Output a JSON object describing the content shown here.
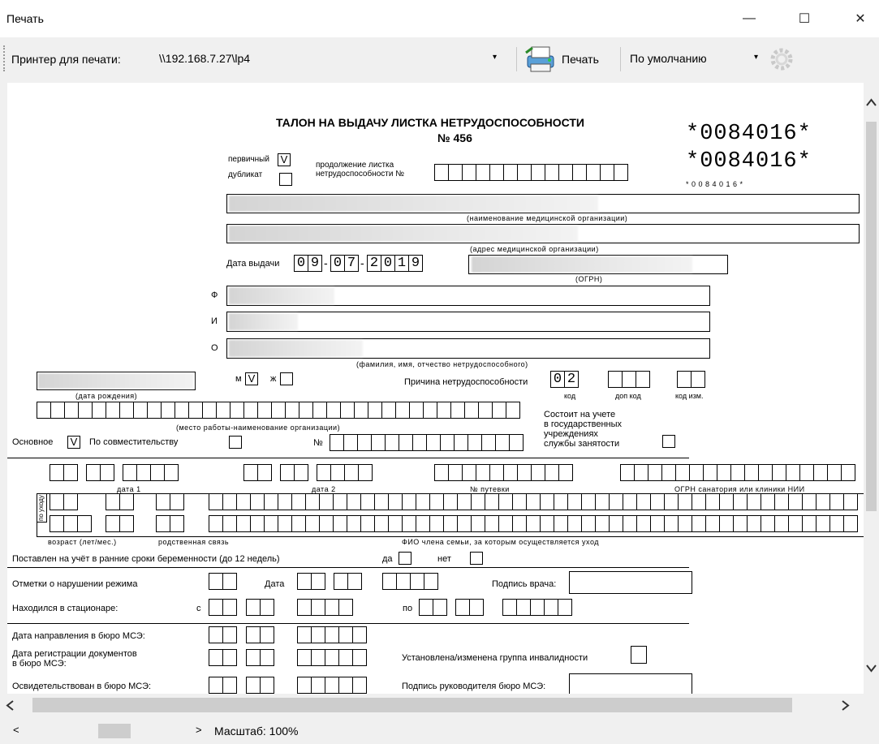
{
  "window": {
    "title": "Печать",
    "minimize": "—",
    "maximize": "☐",
    "close": "✕"
  },
  "toolbar": {
    "printer_label": "Принтер для печати:",
    "printer_value": "\\\\192.168.7.27\\lp4",
    "print_button": "Печать",
    "mode_value": "По умолчанию",
    "dropdown_arrow": "▾"
  },
  "doc": {
    "title": "ТАЛОН НА ВЫДАЧУ ЛИСТКА НЕТРУДОСПОСОБНОСТИ",
    "number": "№ 456",
    "barcode1": "*0084016*",
    "barcode2": "*0084016*",
    "barcode_caption": "* 0 0 8 4 0 1 6 *",
    "primary_label": "первичный",
    "primary_mark": "V",
    "duplicate_label": "дубликат",
    "continuation_label_1": "продолжение листка",
    "continuation_label_2": "нетрудоспособности №",
    "org_name_caption": "(наименование медицинской организации)",
    "org_address_caption": "(адрес медицинской организации)",
    "issue_date_label": "Дата выдачи",
    "issue_date": [
      "0",
      "9",
      "0",
      "7",
      "2",
      "0",
      "1",
      "9"
    ],
    "ogrn_caption": "(ОГРН)",
    "f_label": "Ф",
    "i_label": "И",
    "o_label": "О",
    "fio_caption": "(фамилия, имя, отчество нетрудоспособного)",
    "male_label": "м",
    "male_mark": "V",
    "female_label": "ж",
    "reason_label": "Причина нетрудоспособности",
    "reason_code": [
      "0",
      "2"
    ],
    "code_caption": "код",
    "add_code_caption": "доп код",
    "change_code_caption": "код изм.",
    "birthdate_caption": "(дата рождения)",
    "workplace_caption": "(место работы-наименование организации)",
    "employment_1": "Состоит на учете",
    "employment_2": "в государственных",
    "employment_3": "учреждениях",
    "employment_4": "службы занятости",
    "main_label": "Основное",
    "main_mark": "V",
    "parttime_label": "По совместительству",
    "no_label": "№",
    "date1_caption": "дата 1",
    "date2_caption": "дата 2",
    "voucher_caption": "№ путевки",
    "sanatorium_caption": "ОГРН санатория или клиники НИИ",
    "care_vertical": "по уходу",
    "age_caption": "возраст (лет/мес.)",
    "relation_caption": "родственная связь",
    "family_caption": "ФИО члена семьи, за которым осуществляется уход",
    "pregnancy_label": "Поставлен на учёт в ранние сроки беременности (до 12 недель)",
    "yes_label": "да",
    "no_word": "нет",
    "violation_label": "Отметки о нарушении режима",
    "date_label": "Дата",
    "doctor_sign": "Подпись врача:",
    "hospital_label": "Находился в стационаре:",
    "from_label": "с",
    "to_label": "по",
    "mse_direction": "Дата направления в бюро МСЭ:",
    "mse_registration_1": "Дата регистрации документов",
    "mse_registration_2": "в бюро МСЭ:",
    "disability_group": "Установлена/изменена группа инвалидности",
    "mse_examined": "Освидетельствован в бюро МСЭ:",
    "mse_head_sign": "Подпись руководителя бюро МСЭ:"
  },
  "status": {
    "zoom": "Масштаб: 100%",
    "left": "<",
    "right": ">"
  }
}
